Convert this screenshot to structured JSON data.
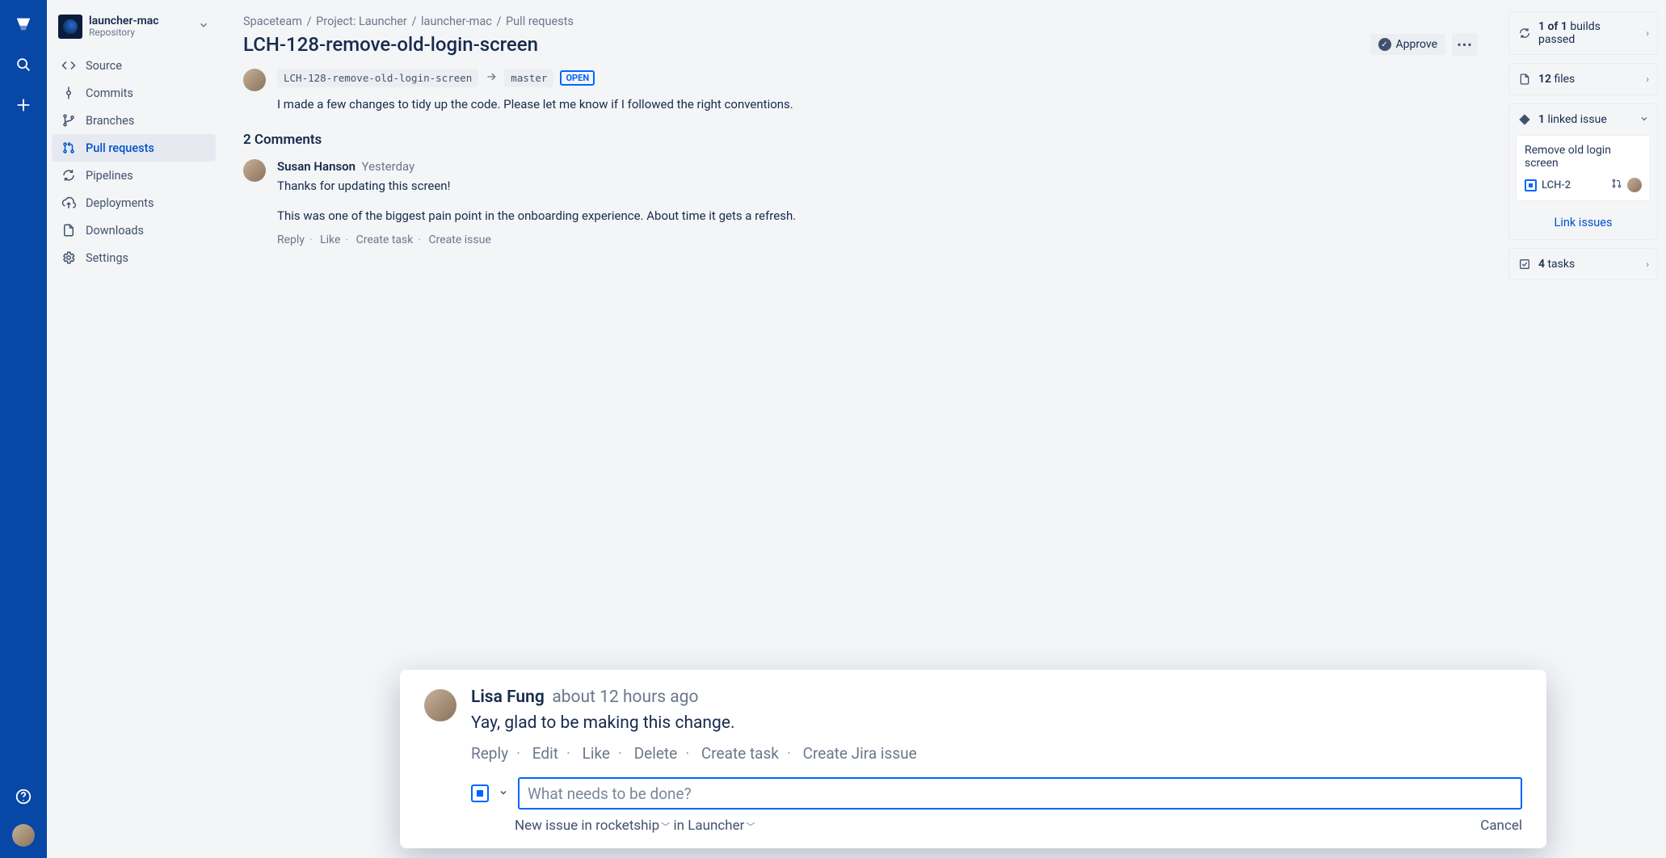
{
  "repo": {
    "name": "launcher-mac",
    "type": "Repository"
  },
  "sidebar": {
    "items": [
      {
        "label": "Source"
      },
      {
        "label": "Commits"
      },
      {
        "label": "Branches"
      },
      {
        "label": "Pull requests"
      },
      {
        "label": "Pipelines"
      },
      {
        "label": "Deployments"
      },
      {
        "label": "Downloads"
      },
      {
        "label": "Settings"
      }
    ]
  },
  "breadcrumbs": {
    "a": "Spaceteam",
    "b": "Project: Launcher",
    "c": "launcher-mac",
    "d": "Pull requests"
  },
  "pr": {
    "title": "LCH-128-remove-old-login-screen",
    "approve_label": "Approve",
    "source_branch": "LCH-128-remove-old-login-screen",
    "target_branch": "master",
    "status_badge": "OPEN",
    "body": "I made a few changes to tidy up the code. Please let me know if I followed the right conventions."
  },
  "comments": {
    "heading": "2 Comments",
    "items": [
      {
        "author": "Susan Hanson",
        "time": "Yesterday",
        "body1": "Thanks for updating this screen!",
        "body2": "This was one of the biggest pain point in the onboarding experience. About time it gets a refresh.",
        "actions": {
          "reply": "Reply",
          "like": "Like",
          "create_task": "Create task",
          "create_issue": "Create issue"
        }
      }
    ]
  },
  "float": {
    "author": "Lisa Fung",
    "time": "about 12 hours ago",
    "body": "Yay, glad to be making this change.",
    "actions": {
      "reply": "Reply",
      "edit": "Edit",
      "like": "Like",
      "delete": "Delete",
      "create_task": "Create task",
      "create_jira": "Create Jira issue"
    },
    "input_placeholder": "What needs to be done?",
    "sub_project_prefix": "New issue in ",
    "sub_project": "rocketship",
    "sub_in": " in ",
    "sub_space": "Launcher",
    "cancel": "Cancel"
  },
  "right": {
    "builds": {
      "bold": "1 of 1",
      "rest": " builds passed"
    },
    "files": {
      "bold": "12",
      "rest": " files"
    },
    "linked": {
      "bold": "1",
      "rest": " linked issue"
    },
    "issue": {
      "title": "Remove old login screen",
      "key": "LCH-2"
    },
    "link_issues": "Link issues",
    "tasks": {
      "bold": "4",
      "rest": " tasks"
    }
  }
}
